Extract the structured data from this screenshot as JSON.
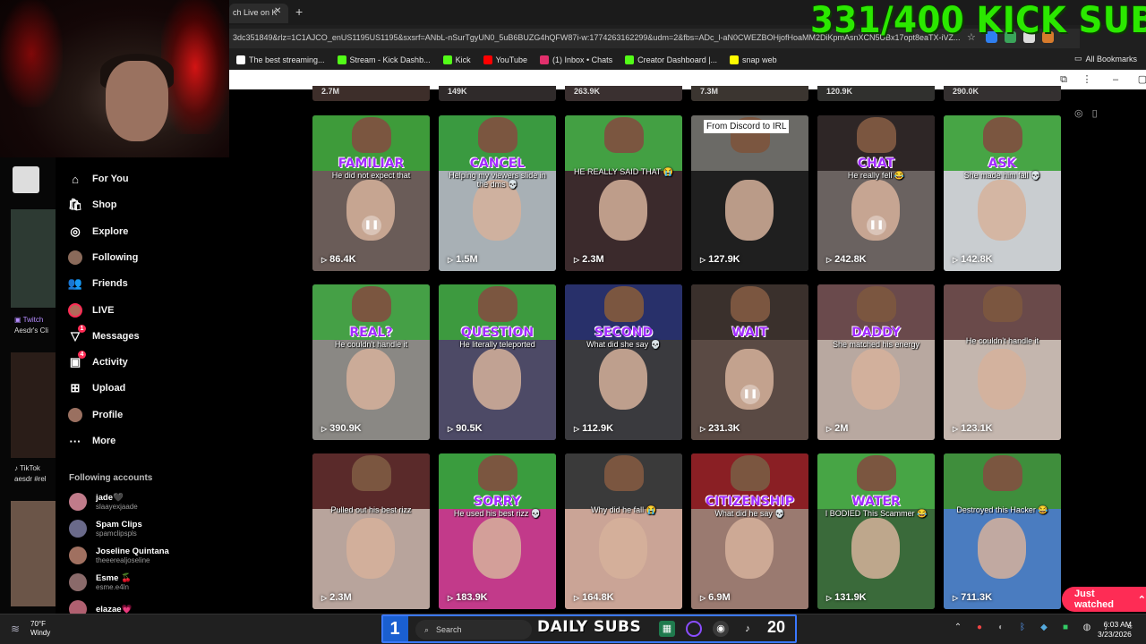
{
  "overlay": {
    "subs_counter": "331/400 KICK SUBS"
  },
  "browser": {
    "tab_title": "ch Live on K",
    "url": "3dc351849&rlz=1C1AJCO_enUS1195US1195&sxsrf=ANbL-nSurTgyUN0_5uB6BUZG4hQFW87i-w:1774263162299&udm=2&fbs=ADc_l-aN0CWEZBOHjofHoaMM2DiKpmAsnXCN5UBx17opt8eaTX-iVZ...",
    "bookmarks": [
      {
        "label": "The best streaming...",
        "color": "#ffffff"
      },
      {
        "label": "Stream - Kick Dashb...",
        "color": "#53fc18"
      },
      {
        "label": "Kick",
        "color": "#53fc18"
      },
      {
        "label": "YouTube",
        "color": "#ff0000"
      },
      {
        "label": "(1) Inbox • Chats",
        "color": "#e1306c"
      },
      {
        "label": "Creator Dashboard |...",
        "color": "#53fc18"
      },
      {
        "label": "snap web",
        "color": "#fffc00"
      }
    ],
    "all_bookmarks": "All Bookmarks"
  },
  "left_strip": {
    "items": [
      {
        "source": "Twitch",
        "text": "Aesdr's Cli"
      },
      {
        "source": "TikTok",
        "text": "aesdr #rel"
      },
      {
        "source": "TikTok",
        "text": ""
      }
    ]
  },
  "sidebar": {
    "nav": [
      {
        "label": "For You",
        "icon": "home-icon",
        "glyph": "⌂"
      },
      {
        "label": "Shop",
        "icon": "shop-icon",
        "glyph": "🛍"
      },
      {
        "label": "Explore",
        "icon": "compass-icon",
        "glyph": "◎"
      },
      {
        "label": "Following",
        "icon": "avatar-icon",
        "glyph": ""
      },
      {
        "label": "Friends",
        "icon": "friends-icon",
        "glyph": "👥"
      },
      {
        "label": "LIVE",
        "icon": "live-icon",
        "glyph": ""
      },
      {
        "label": "Messages",
        "icon": "messages-icon",
        "glyph": "▽",
        "badge": "1"
      },
      {
        "label": "Activity",
        "icon": "activity-icon",
        "glyph": "▣",
        "badge": "4"
      },
      {
        "label": "Upload",
        "icon": "upload-icon",
        "glyph": "⊞"
      },
      {
        "label": "Profile",
        "icon": "profile-icon",
        "glyph": ""
      },
      {
        "label": "More",
        "icon": "more-icon",
        "glyph": "···"
      }
    ],
    "following_title": "Following accounts",
    "following": [
      {
        "name": "jade🖤",
        "handle": "slaayexjaade"
      },
      {
        "name": "Spam Clips",
        "handle": "spamclipspls"
      },
      {
        "name": "Joseline Quintana",
        "handle": "theeerealjoseline"
      },
      {
        "name": "Esme 🍒",
        "handle": "esme.e4ln"
      },
      {
        "name": "elazae💗",
        "handle": ""
      }
    ]
  },
  "grid": {
    "top_row": [
      "2.7M",
      "149K",
      "263.9K",
      "7.3M",
      "120.9K",
      "290.0K"
    ],
    "cards": [
      {
        "views": "86.4K",
        "word": "FAMILIAR",
        "caption": "He did not expect that",
        "paused": true
      },
      {
        "views": "1.5M",
        "word": "CANCEL",
        "caption": "Helping my viewers slide in the dms 💀",
        "paused": false
      },
      {
        "views": "2.3M",
        "word": "",
        "caption": "HE REALLY SAID THAT 😭",
        "paused": false
      },
      {
        "views": "127.9K",
        "word": "",
        "caption": "",
        "tag": "From Discord to IRL",
        "paused": false
      },
      {
        "views": "242.8K",
        "word": "CHAT",
        "caption": "He really fell 😂",
        "paused": true
      },
      {
        "views": "142.8K",
        "word": "ASK",
        "caption": "She made him fall 💀",
        "paused": false
      },
      {
        "views": "390.9K",
        "word": "REAL?",
        "caption": "He couldn't handle it",
        "paused": false
      },
      {
        "views": "90.5K",
        "word": "QUESTION",
        "caption": "He literally teleported",
        "paused": false
      },
      {
        "views": "112.9K",
        "word": "SECOND",
        "caption": "What did she say 💀",
        "paused": false
      },
      {
        "views": "231.3K",
        "word": "WAIT",
        "caption": "",
        "paused": true
      },
      {
        "views": "2M",
        "word": "DADDY",
        "caption": "She matched his energy",
        "paused": false
      },
      {
        "views": "123.1K",
        "word": "",
        "caption": "He couldn't handle it",
        "paused": false
      },
      {
        "views": "2.3M",
        "word": "",
        "caption": "Pulled out his best rizz",
        "paused": false
      },
      {
        "views": "183.9K",
        "word": "SORRY",
        "caption": "He used his best rizz 💀",
        "paused": false
      },
      {
        "views": "164.8K",
        "word": "",
        "caption": "Why did he fall 😭",
        "paused": false
      },
      {
        "views": "6.9M",
        "word": "CITIZENSHIP",
        "caption": "What did he say 💀",
        "paused": false
      },
      {
        "views": "131.9K",
        "word": "WATER",
        "caption": "I BODIED This Scammer 😂",
        "paused": false
      },
      {
        "views": "711.3K",
        "word": "",
        "caption": "Destroyed this Hacker 😂",
        "paused": false
      }
    ],
    "just_watched": "Just watched"
  },
  "taskbar": {
    "weather_temp": "70°F",
    "weather_desc": "Windy",
    "search_placeholder": "Search",
    "daily_label": "DAILY SUBS",
    "daily_count": "20",
    "time": "6:03 AM",
    "date": "3/23/2026"
  }
}
